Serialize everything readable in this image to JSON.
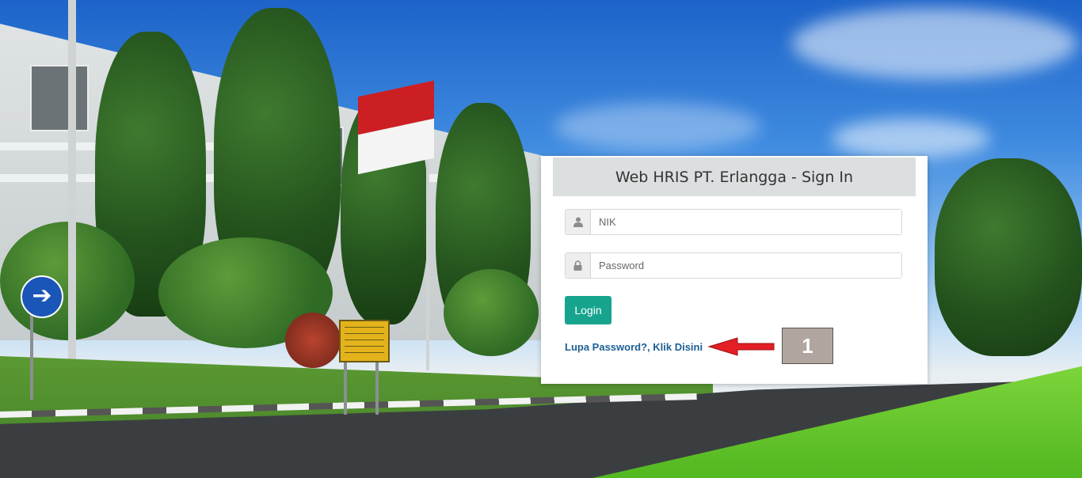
{
  "login": {
    "title": "Web HRIS PT. Erlangga - Sign In",
    "nik_placeholder": "NIK",
    "password_placeholder": "Password",
    "login_label": "Login",
    "forgot_label": "Lupa Password?, Klik Disini"
  },
  "annotation": {
    "step_number": "1",
    "marker_color": "#e31e24"
  },
  "icons": {
    "nik": "user-icon",
    "password": "lock-icon",
    "sign": "arrow-right-icon"
  },
  "colors": {
    "accent": "#17a48f",
    "link": "#1e5f94",
    "header_bg": "#dcdfe0"
  }
}
